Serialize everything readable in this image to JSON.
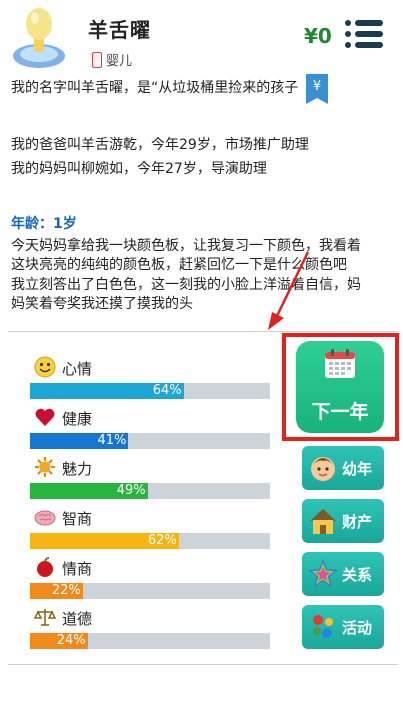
{
  "header": {
    "name": "羊舌曜",
    "stage": "婴儿",
    "money": "¥0",
    "avatar_icon": "pacifier-icon",
    "menu_icon": "hamburger-menu-icon"
  },
  "story": {
    "lines": [
      "我的名字叫羊舌曜，是“从垃圾桶里捡来的孩子",
      "我的爸爸叫羊舌游乾，今年29岁，市场推广助理",
      "我的妈妈叫柳婉如，今年27岁，导演助理",
      "年龄：1岁",
      "今天妈妈拿给我一块颜色板，让我复习一下颜色，我看着",
      "这块亮亮的纯纯的颜色板，赶紧回忆一下是什么颜色吧",
      "我立刻答出了白色色，这一刻我的小脸上洋溢着自信，妈",
      "妈笑着夸奖我还摸了摸我的头"
    ],
    "bookmark": "¥"
  },
  "stats": [
    {
      "label": "心情",
      "value": 64,
      "text": "64%",
      "color": "#1ea7d6",
      "icon": "smiley-face-icon"
    },
    {
      "label": "健康",
      "value": 41,
      "text": "41%",
      "color": "#1577d2",
      "icon": "heart-icon"
    },
    {
      "label": "魅力",
      "value": 49,
      "text": "49%",
      "color": "#27b53f",
      "icon": "sun-icon"
    },
    {
      "label": "智商",
      "value": 62,
      "text": "62%",
      "color": "#f5b512",
      "icon": "brain-icon"
    },
    {
      "label": "情商",
      "value": 22,
      "text": "22%",
      "color": "#f08a1c",
      "icon": "apple-icon"
    },
    {
      "label": "道德",
      "value": 24,
      "text": "24%",
      "color": "#f08a1c",
      "icon": "scales-icon"
    }
  ],
  "actions": {
    "next_year": "下一年",
    "childhood": "幼年",
    "property": "财产",
    "relations": "关系",
    "activities": "活动"
  }
}
